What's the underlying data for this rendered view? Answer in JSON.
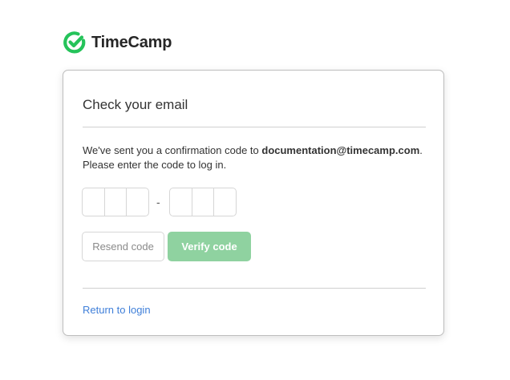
{
  "brand": {
    "name": "TimeCamp",
    "icon": "timecamp-check-logo-icon",
    "color": "#25c35a"
  },
  "card": {
    "title": "Check your email",
    "message_prefix": "We've sent you a confirmation code to ",
    "email": "documentation@timecamp.com",
    "message_suffix": ".",
    "message_line2": "Please enter the code to log in.",
    "code_separator": "-",
    "code_first_group": [
      "",
      "",
      ""
    ],
    "code_second_group": [
      "",
      "",
      ""
    ]
  },
  "buttons": {
    "resend_label": "Resend code",
    "verify_label": "Verify code",
    "verify_color": "#8fd2a0"
  },
  "footer": {
    "return_link_label": "Return to login",
    "link_color": "#3f7fd9"
  }
}
